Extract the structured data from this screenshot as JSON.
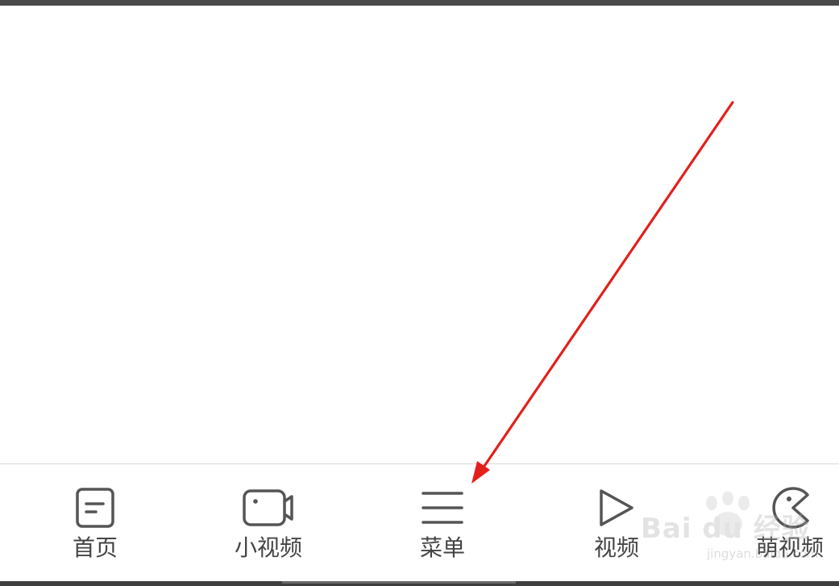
{
  "tabbar": {
    "items": [
      {
        "label": "首页",
        "icon": "document-icon"
      },
      {
        "label": "小视频",
        "icon": "camera-icon"
      },
      {
        "label": "菜单",
        "icon": "menu-icon"
      },
      {
        "label": "视频",
        "icon": "play-icon"
      },
      {
        "label": "萌视频",
        "icon": "pacman-icon"
      }
    ]
  },
  "watermark": {
    "brand": "Bai du 经验",
    "url": "jingyan.baidu.com"
  },
  "annotation": {
    "type": "arrow",
    "color": "#e3201b",
    "target": "菜单"
  },
  "colors": {
    "background": "#ffffff",
    "icon_stroke": "#555555",
    "label_text": "#444444",
    "divider": "#d9d9d9",
    "arrow": "#e3201b"
  }
}
